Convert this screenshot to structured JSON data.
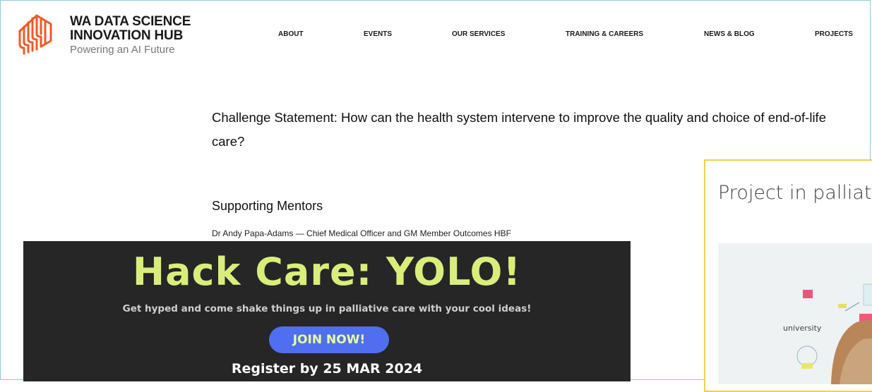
{
  "header": {
    "brand_line1": "WA DATA SCIENCE",
    "brand_line2": "INNOVATION HUB",
    "tagline": "Powering an AI Future",
    "logo_icon": "hub-logo-icon",
    "accent_color": "#f05a28"
  },
  "nav": {
    "items": [
      {
        "label": "ABOUT"
      },
      {
        "label": "EVENTS"
      },
      {
        "label": "OUR SERVICES"
      },
      {
        "label": "TRAINING & CAREERS"
      },
      {
        "label": "NEWS & BLOG"
      },
      {
        "label": "PROJECTS"
      }
    ]
  },
  "content": {
    "challenge_line1": "Challenge Statement: How can the health system intervene to improve the quality and choice of end-of-life",
    "challenge_line2": "care?",
    "mentors_heading": "Supporting Mentors",
    "mentor_1": "Dr Andy Papa-Adams — Chief Medical Officer and GM Member Outcomes HBF"
  },
  "side_card": {
    "title": "Project in palliat",
    "border_color": "#f5d046",
    "whiteboard_word": "university"
  },
  "banner": {
    "title": "Hack Care: YOLO!",
    "subtitle": "Get hyped and come shake things up in palliative care with your cool ideas!",
    "button_label": "JOIN NOW!",
    "register_text": "Register by 25 MAR 2024",
    "background_color": "#262626",
    "title_color": "#d9ee7a",
    "button_color": "#4f6ff0"
  }
}
